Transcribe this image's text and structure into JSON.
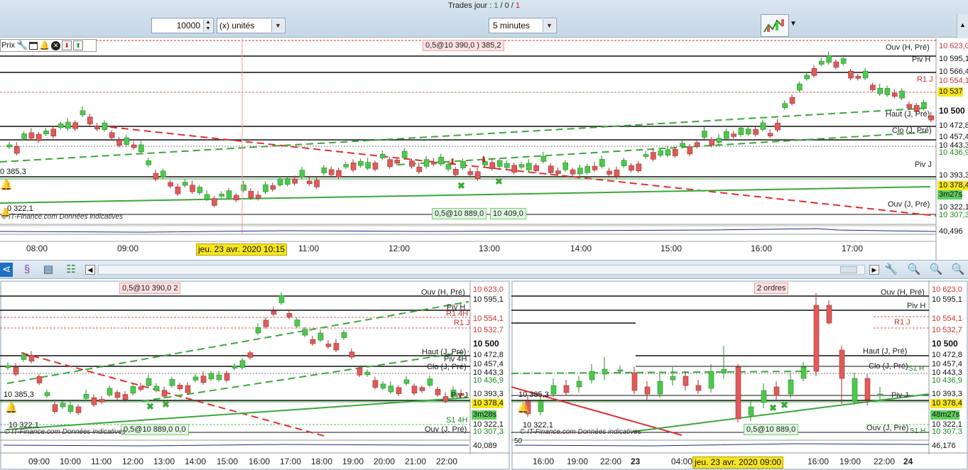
{
  "header": {
    "trades_label": "Trades jour : ",
    "trades_a": "1",
    "trades_sep1": " / ",
    "trades_b": "0",
    "trades_sep2": " / ",
    "trades_c": "1",
    "quantity_value": "10000",
    "units_select": "(x) unités",
    "timeframe_select": "5 minutes"
  },
  "main_chart": {
    "toolbar_label": "Prix",
    "order_top": "0,5@10 390,0 ) 385,2",
    "order_bottom_a": "0,5@10 889,0",
    "order_bottom_b": "10 409,0",
    "left_label_1": "0 385,3",
    "left_label_2": "0 322,1",
    "watermark": "© IT-Finance.com  Données indicatives",
    "level_labels": [
      "Ouv (H, Pré)",
      "Piv H",
      "R1 J",
      "Haut (J, Pré)",
      "Clo (J, Pré)",
      "Piv J",
      "Ouv (J, Pré)"
    ],
    "axis_prices": [
      "10 623,0",
      "10 595,1",
      "10 566,4",
      "10 554,1",
      "10 537",
      "10 500",
      "10 472,8",
      "10 457,4",
      "10 443,3",
      "10 436,9",
      "10 393,3",
      "10 378,4",
      "3m27s",
      "10 322,1",
      "10 307,3",
      "40,496"
    ],
    "times": [
      "08:00",
      "09:00",
      "11:00",
      "12:00",
      "13:00",
      "14:00",
      "15:00",
      "16:00",
      "17:00"
    ],
    "date_badge": "jeu. 23 avr. 2020 10:15"
  },
  "bottom_left_chart": {
    "order_top": "0,5@10 390,0  2",
    "order_bottom": "0,5@10 889,0  0,0",
    "left_label_1": "10 385,3",
    "left_label_2": "10 322,1",
    "watermark": "© IT-Finance.com  Données indicatives",
    "level_labels": [
      "Ouv (H, Pré)",
      "Piv H",
      "R1 4H",
      "R1 J",
      "Haut (J, Pré)",
      "Piv 4H",
      "Clo (J, Pré)",
      "Piv J",
      "S1 4H",
      "Ouv (J, Pré)"
    ],
    "axis_prices": [
      "10 623,0",
      "10 595,1",
      "10 554,1",
      "10 532,7",
      "10 500",
      "10 472,8",
      "10 457,4",
      "10 443,3",
      "10 436,9",
      "10 393,3",
      "10 378,4",
      "3m28s",
      "10 322,1",
      "10 307,3",
      "40,089"
    ],
    "times": [
      "09:00",
      "10:00",
      "11:00",
      "12:00",
      "13:00",
      "14:00",
      "15:00",
      "16:00",
      "17:00",
      "18:00",
      "19:00",
      "20:00",
      "21:00",
      "22:00"
    ]
  },
  "bottom_right_chart": {
    "order_top": "2 ordres",
    "order_bottom": "0,5@10 889,0",
    "left_label_1": "10 385,3",
    "left_label_2": "10 322,1",
    "left_label_3": "50",
    "watermark": "© IT-Finance.com  Données indicatives",
    "level_labels": [
      "Ouv (H, Pré)",
      "Piv H",
      "R1 J",
      "Haut (J, Pré)",
      "Clo (J, Pré)",
      "S1 H",
      "Piv J",
      "Ouv (J, Pré)",
      "S1 H"
    ],
    "axis_prices": [
      "10 623,0",
      "10 595,1",
      "10 554,1",
      "10 532,7",
      "10 500",
      "10 472,8",
      "10 457,4",
      "10 443,3",
      "10 436,9",
      "10 393,3",
      "10 378,4",
      "48m27s",
      "10 322,1",
      "10 307,3",
      "46,176"
    ],
    "times": [
      "16:00",
      "19:00",
      "22:00",
      "23",
      "04:00",
      "16:00",
      "19:00",
      "22:00",
      "24"
    ],
    "date_badge": "jeu. 23 avr. 2020 09:00"
  },
  "colors": {
    "up": "#4cc94c",
    "down": "#e05a5a",
    "trend_red": "#e03030",
    "trend_green": "#3aa83a",
    "highlight_yellow": "#f7e51e"
  },
  "icons": [
    "wrench-icon",
    "window-icon",
    "bell-icon",
    "close-icon",
    "sell-arrow-icon",
    "buy-arrow-icon",
    "chart-type-icon",
    "share-icon",
    "indicator-icon",
    "draw-icon",
    "zoom-fit-icon",
    "zoom-out-icon",
    "zoom-in-icon",
    "alert-bell-icon"
  ]
}
